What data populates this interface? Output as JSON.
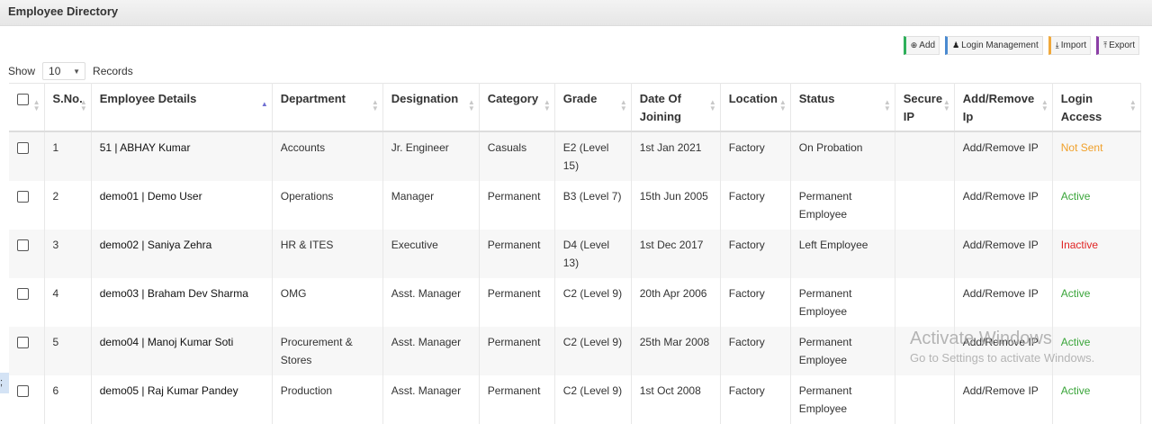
{
  "header": {
    "title": "Employee Directory"
  },
  "toolbar": {
    "add": "Add",
    "login_management": "Login Management",
    "import": "Import",
    "export": "Export"
  },
  "show": {
    "label": "Show",
    "value": "10",
    "suffix": "Records"
  },
  "table": {
    "headers": [
      "S.No.",
      "Employee Details",
      "Department",
      "Designation",
      "Category",
      "Grade",
      "Date Of Joining",
      "Location",
      "Status",
      "Secure IP",
      "Add/Remove Ip",
      "Login Access"
    ],
    "rows": [
      {
        "sno": "1",
        "emp": "51 | ABHAY  Kumar",
        "dept": "Accounts",
        "desig": "Jr. Engineer",
        "cat": "Casuals",
        "grade": "E2 (Level 15)",
        "doj": "1st Jan 2021",
        "loc": "Factory",
        "status": "On Probation",
        "secure": "",
        "addrem": "Add/Remove IP",
        "login": "Not Sent"
      },
      {
        "sno": "2",
        "emp": "demo01 | Demo User",
        "dept": "Operations",
        "desig": "Manager",
        "cat": "Permanent",
        "grade": "B3 (Level 7)",
        "doj": "15th Jun 2005",
        "loc": "Factory",
        "status": "Permanent Employee",
        "secure": "",
        "addrem": "Add/Remove IP",
        "login": "Active"
      },
      {
        "sno": "3",
        "emp": "demo02 | Saniya Zehra",
        "dept": "HR & ITES",
        "desig": "Executive",
        "cat": "Permanent",
        "grade": "D4 (Level 13)",
        "doj": "1st Dec 2017",
        "loc": "Factory",
        "status": "Left Employee",
        "secure": "",
        "addrem": "Add/Remove IP",
        "login": "Inactive"
      },
      {
        "sno": "4",
        "emp": "demo03 | Braham Dev Sharma",
        "dept": "OMG",
        "desig": "Asst. Manager",
        "cat": "Permanent",
        "grade": "C2 (Level 9)",
        "doj": "20th Apr 2006",
        "loc": "Factory",
        "status": "Permanent Employee",
        "secure": "",
        "addrem": "Add/Remove IP",
        "login": "Active"
      },
      {
        "sno": "5",
        "emp": "demo04 | Manoj Kumar Soti",
        "dept": "Procurement & Stores",
        "desig": "Asst. Manager",
        "cat": "Permanent",
        "grade": "C2 (Level 9)",
        "doj": "25th Mar 2008",
        "loc": "Factory",
        "status": "Permanent Employee",
        "secure": "",
        "addrem": "Add/Remove IP",
        "login": "Active"
      },
      {
        "sno": "6",
        "emp": "demo05 | Raj Kumar Pandey",
        "dept": "Production",
        "desig": "Asst. Manager",
        "cat": "Permanent",
        "grade": "C2 (Level 9)",
        "doj": "1st Oct 2008",
        "loc": "Factory",
        "status": "Permanent Employee",
        "secure": "",
        "addrem": "Add/Remove IP",
        "login": "Active"
      }
    ]
  },
  "watermark": {
    "line1": "Activate Windows",
    "line2": "Go to Settings to activate Windows."
  },
  "edge_mark": ";"
}
